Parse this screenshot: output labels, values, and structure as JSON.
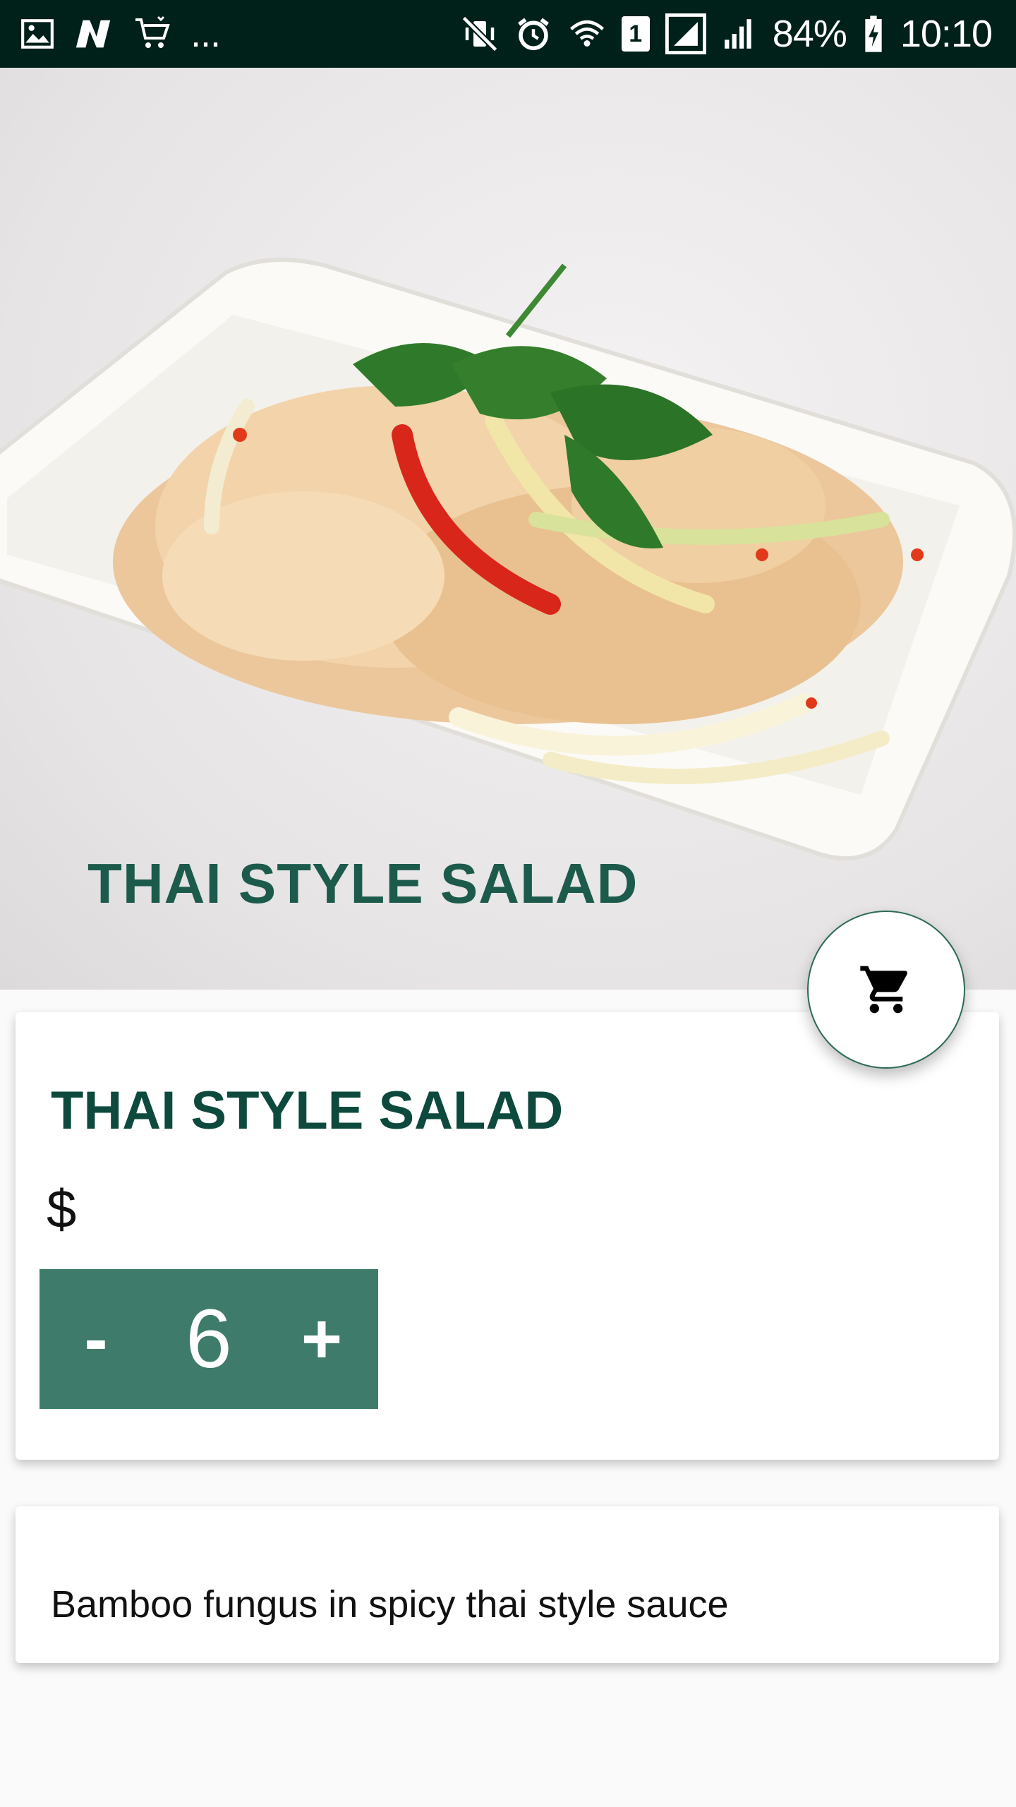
{
  "status_bar": {
    "battery": "84%",
    "time": "10:10",
    "sim_slot": "1",
    "left_icons": [
      "image-icon",
      "n-app-icon",
      "cart-app-icon",
      "more-notifications-icon"
    ],
    "more_text": "..."
  },
  "hero": {
    "title": "THAI STYLE SALAD",
    "image": "salad-plate-photo"
  },
  "cart_button": {
    "icon": "cart-icon"
  },
  "item": {
    "name": "THAI STYLE SALAD",
    "price": "$",
    "stepper": {
      "minus": "-",
      "quantity": "6",
      "plus": "+"
    }
  },
  "description": "Bamboo fungus in spicy thai style sauce",
  "colors": {
    "status_bar": "#00201a",
    "accent": "#3e7b6a",
    "title_green": "#0d4a3d"
  }
}
